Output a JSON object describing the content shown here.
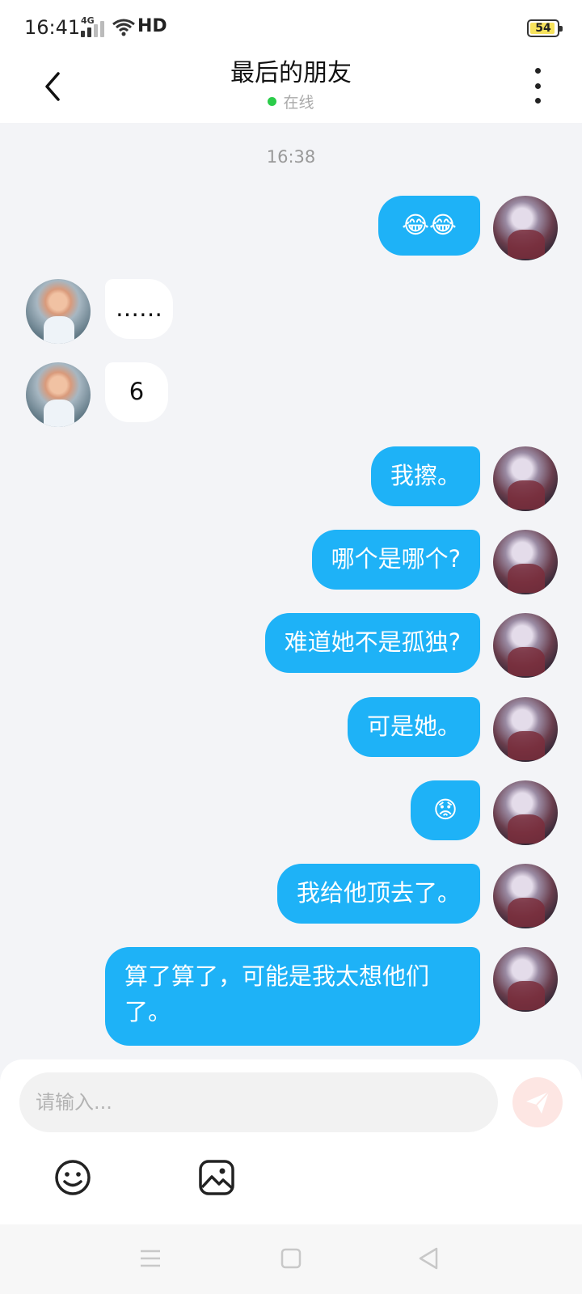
{
  "status_bar": {
    "time": "16:41",
    "network": "4G",
    "wifi_label": "HD",
    "battery": "54"
  },
  "header": {
    "title": "最后的朋友",
    "status": "在线"
  },
  "chat": {
    "timestamp": "16:38",
    "messages": [
      {
        "sender": "me",
        "text": "😂😂"
      },
      {
        "sender": "friend",
        "text": "……"
      },
      {
        "sender": "friend",
        "text": "6"
      },
      {
        "sender": "me",
        "text": "我擦。"
      },
      {
        "sender": "me",
        "text": "哪个是哪个?"
      },
      {
        "sender": "me",
        "text": "难道她不是孤独?"
      },
      {
        "sender": "me",
        "text": "可是她。"
      },
      {
        "sender": "me",
        "text": "😟"
      },
      {
        "sender": "me",
        "text": "我给他顶去了。"
      },
      {
        "sender": "me",
        "text": "算了算了，可能是我太想他们了。"
      }
    ]
  },
  "composer": {
    "placeholder": "请输入..."
  },
  "icons": {
    "back": "chevron-left-icon",
    "more": "more-vertical-icon",
    "send": "send-icon",
    "emoji": "emoji-icon",
    "image": "image-icon",
    "nav_menu": "menu-icon",
    "nav_home": "home-icon",
    "nav_back": "back-triangle-icon"
  },
  "colors": {
    "bubble_me": "#1eb2f7",
    "bubble_friend": "#ffffff",
    "online_dot": "#2bcc4a",
    "send_bg": "#fde6e3"
  }
}
